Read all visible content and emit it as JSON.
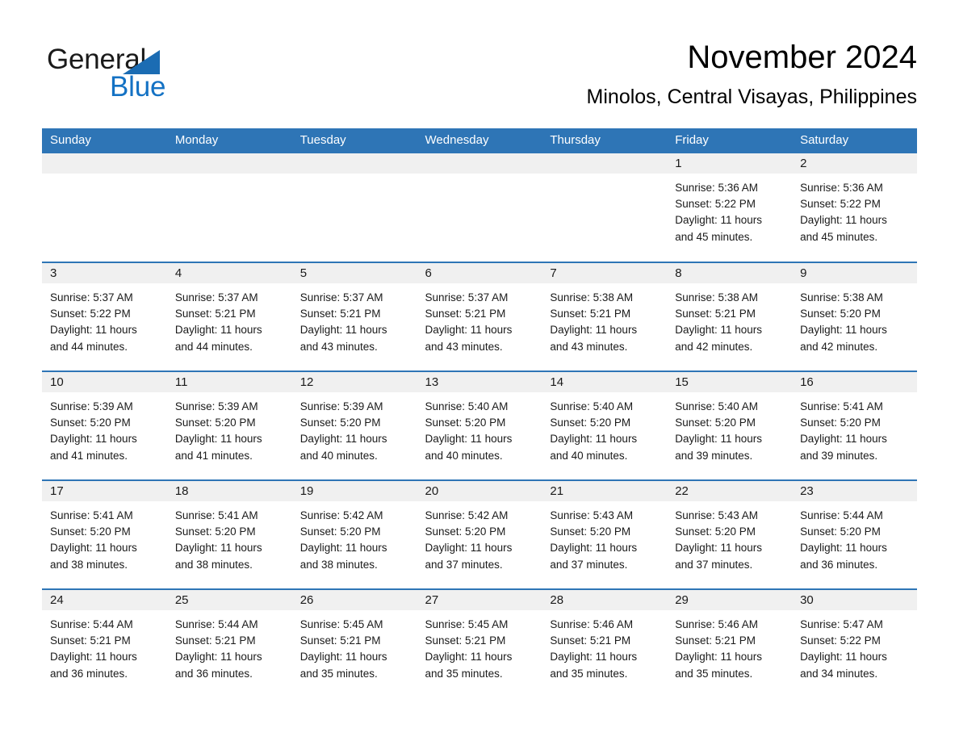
{
  "brand": {
    "name_part1": "General",
    "name_part2": "Blue",
    "triangle_color": "#1b6cb3",
    "blue_text_color": "#1472c4"
  },
  "header": {
    "title": "November 2024",
    "subtitle": "Minolos, Central Visayas, Philippines"
  },
  "theme": {
    "header_bg": "#2e75b6",
    "daynum_bg": "#f0f0f0",
    "week_divider": "#2e75b6"
  },
  "weekdays": [
    "Sunday",
    "Monday",
    "Tuesday",
    "Wednesday",
    "Thursday",
    "Friday",
    "Saturday"
  ],
  "weeks": [
    [
      {
        "day": "",
        "sunrise": "",
        "sunset": "",
        "daylight_line1": "",
        "daylight_line2": "",
        "empty": true
      },
      {
        "day": "",
        "sunrise": "",
        "sunset": "",
        "daylight_line1": "",
        "daylight_line2": "",
        "empty": true
      },
      {
        "day": "",
        "sunrise": "",
        "sunset": "",
        "daylight_line1": "",
        "daylight_line2": "",
        "empty": true
      },
      {
        "day": "",
        "sunrise": "",
        "sunset": "",
        "daylight_line1": "",
        "daylight_line2": "",
        "empty": true
      },
      {
        "day": "",
        "sunrise": "",
        "sunset": "",
        "daylight_line1": "",
        "daylight_line2": "",
        "empty": true
      },
      {
        "day": "1",
        "sunrise": "Sunrise: 5:36 AM",
        "sunset": "Sunset: 5:22 PM",
        "daylight_line1": "Daylight: 11 hours",
        "daylight_line2": "and 45 minutes."
      },
      {
        "day": "2",
        "sunrise": "Sunrise: 5:36 AM",
        "sunset": "Sunset: 5:22 PM",
        "daylight_line1": "Daylight: 11 hours",
        "daylight_line2": "and 45 minutes."
      }
    ],
    [
      {
        "day": "3",
        "sunrise": "Sunrise: 5:37 AM",
        "sunset": "Sunset: 5:22 PM",
        "daylight_line1": "Daylight: 11 hours",
        "daylight_line2": "and 44 minutes."
      },
      {
        "day": "4",
        "sunrise": "Sunrise: 5:37 AM",
        "sunset": "Sunset: 5:21 PM",
        "daylight_line1": "Daylight: 11 hours",
        "daylight_line2": "and 44 minutes."
      },
      {
        "day": "5",
        "sunrise": "Sunrise: 5:37 AM",
        "sunset": "Sunset: 5:21 PM",
        "daylight_line1": "Daylight: 11 hours",
        "daylight_line2": "and 43 minutes."
      },
      {
        "day": "6",
        "sunrise": "Sunrise: 5:37 AM",
        "sunset": "Sunset: 5:21 PM",
        "daylight_line1": "Daylight: 11 hours",
        "daylight_line2": "and 43 minutes."
      },
      {
        "day": "7",
        "sunrise": "Sunrise: 5:38 AM",
        "sunset": "Sunset: 5:21 PM",
        "daylight_line1": "Daylight: 11 hours",
        "daylight_line2": "and 43 minutes."
      },
      {
        "day": "8",
        "sunrise": "Sunrise: 5:38 AM",
        "sunset": "Sunset: 5:21 PM",
        "daylight_line1": "Daylight: 11 hours",
        "daylight_line2": "and 42 minutes."
      },
      {
        "day": "9",
        "sunrise": "Sunrise: 5:38 AM",
        "sunset": "Sunset: 5:20 PM",
        "daylight_line1": "Daylight: 11 hours",
        "daylight_line2": "and 42 minutes."
      }
    ],
    [
      {
        "day": "10",
        "sunrise": "Sunrise: 5:39 AM",
        "sunset": "Sunset: 5:20 PM",
        "daylight_line1": "Daylight: 11 hours",
        "daylight_line2": "and 41 minutes."
      },
      {
        "day": "11",
        "sunrise": "Sunrise: 5:39 AM",
        "sunset": "Sunset: 5:20 PM",
        "daylight_line1": "Daylight: 11 hours",
        "daylight_line2": "and 41 minutes."
      },
      {
        "day": "12",
        "sunrise": "Sunrise: 5:39 AM",
        "sunset": "Sunset: 5:20 PM",
        "daylight_line1": "Daylight: 11 hours",
        "daylight_line2": "and 40 minutes."
      },
      {
        "day": "13",
        "sunrise": "Sunrise: 5:40 AM",
        "sunset": "Sunset: 5:20 PM",
        "daylight_line1": "Daylight: 11 hours",
        "daylight_line2": "and 40 minutes."
      },
      {
        "day": "14",
        "sunrise": "Sunrise: 5:40 AM",
        "sunset": "Sunset: 5:20 PM",
        "daylight_line1": "Daylight: 11 hours",
        "daylight_line2": "and 40 minutes."
      },
      {
        "day": "15",
        "sunrise": "Sunrise: 5:40 AM",
        "sunset": "Sunset: 5:20 PM",
        "daylight_line1": "Daylight: 11 hours",
        "daylight_line2": "and 39 minutes."
      },
      {
        "day": "16",
        "sunrise": "Sunrise: 5:41 AM",
        "sunset": "Sunset: 5:20 PM",
        "daylight_line1": "Daylight: 11 hours",
        "daylight_line2": "and 39 minutes."
      }
    ],
    [
      {
        "day": "17",
        "sunrise": "Sunrise: 5:41 AM",
        "sunset": "Sunset: 5:20 PM",
        "daylight_line1": "Daylight: 11 hours",
        "daylight_line2": "and 38 minutes."
      },
      {
        "day": "18",
        "sunrise": "Sunrise: 5:41 AM",
        "sunset": "Sunset: 5:20 PM",
        "daylight_line1": "Daylight: 11 hours",
        "daylight_line2": "and 38 minutes."
      },
      {
        "day": "19",
        "sunrise": "Sunrise: 5:42 AM",
        "sunset": "Sunset: 5:20 PM",
        "daylight_line1": "Daylight: 11 hours",
        "daylight_line2": "and 38 minutes."
      },
      {
        "day": "20",
        "sunrise": "Sunrise: 5:42 AM",
        "sunset": "Sunset: 5:20 PM",
        "daylight_line1": "Daylight: 11 hours",
        "daylight_line2": "and 37 minutes."
      },
      {
        "day": "21",
        "sunrise": "Sunrise: 5:43 AM",
        "sunset": "Sunset: 5:20 PM",
        "daylight_line1": "Daylight: 11 hours",
        "daylight_line2": "and 37 minutes."
      },
      {
        "day": "22",
        "sunrise": "Sunrise: 5:43 AM",
        "sunset": "Sunset: 5:20 PM",
        "daylight_line1": "Daylight: 11 hours",
        "daylight_line2": "and 37 minutes."
      },
      {
        "day": "23",
        "sunrise": "Sunrise: 5:44 AM",
        "sunset": "Sunset: 5:20 PM",
        "daylight_line1": "Daylight: 11 hours",
        "daylight_line2": "and 36 minutes."
      }
    ],
    [
      {
        "day": "24",
        "sunrise": "Sunrise: 5:44 AM",
        "sunset": "Sunset: 5:21 PM",
        "daylight_line1": "Daylight: 11 hours",
        "daylight_line2": "and 36 minutes."
      },
      {
        "day": "25",
        "sunrise": "Sunrise: 5:44 AM",
        "sunset": "Sunset: 5:21 PM",
        "daylight_line1": "Daylight: 11 hours",
        "daylight_line2": "and 36 minutes."
      },
      {
        "day": "26",
        "sunrise": "Sunrise: 5:45 AM",
        "sunset": "Sunset: 5:21 PM",
        "daylight_line1": "Daylight: 11 hours",
        "daylight_line2": "and 35 minutes."
      },
      {
        "day": "27",
        "sunrise": "Sunrise: 5:45 AM",
        "sunset": "Sunset: 5:21 PM",
        "daylight_line1": "Daylight: 11 hours",
        "daylight_line2": "and 35 minutes."
      },
      {
        "day": "28",
        "sunrise": "Sunrise: 5:46 AM",
        "sunset": "Sunset: 5:21 PM",
        "daylight_line1": "Daylight: 11 hours",
        "daylight_line2": "and 35 minutes."
      },
      {
        "day": "29",
        "sunrise": "Sunrise: 5:46 AM",
        "sunset": "Sunset: 5:21 PM",
        "daylight_line1": "Daylight: 11 hours",
        "daylight_line2": "and 35 minutes."
      },
      {
        "day": "30",
        "sunrise": "Sunrise: 5:47 AM",
        "sunset": "Sunset: 5:22 PM",
        "daylight_line1": "Daylight: 11 hours",
        "daylight_line2": "and 34 minutes."
      }
    ]
  ]
}
